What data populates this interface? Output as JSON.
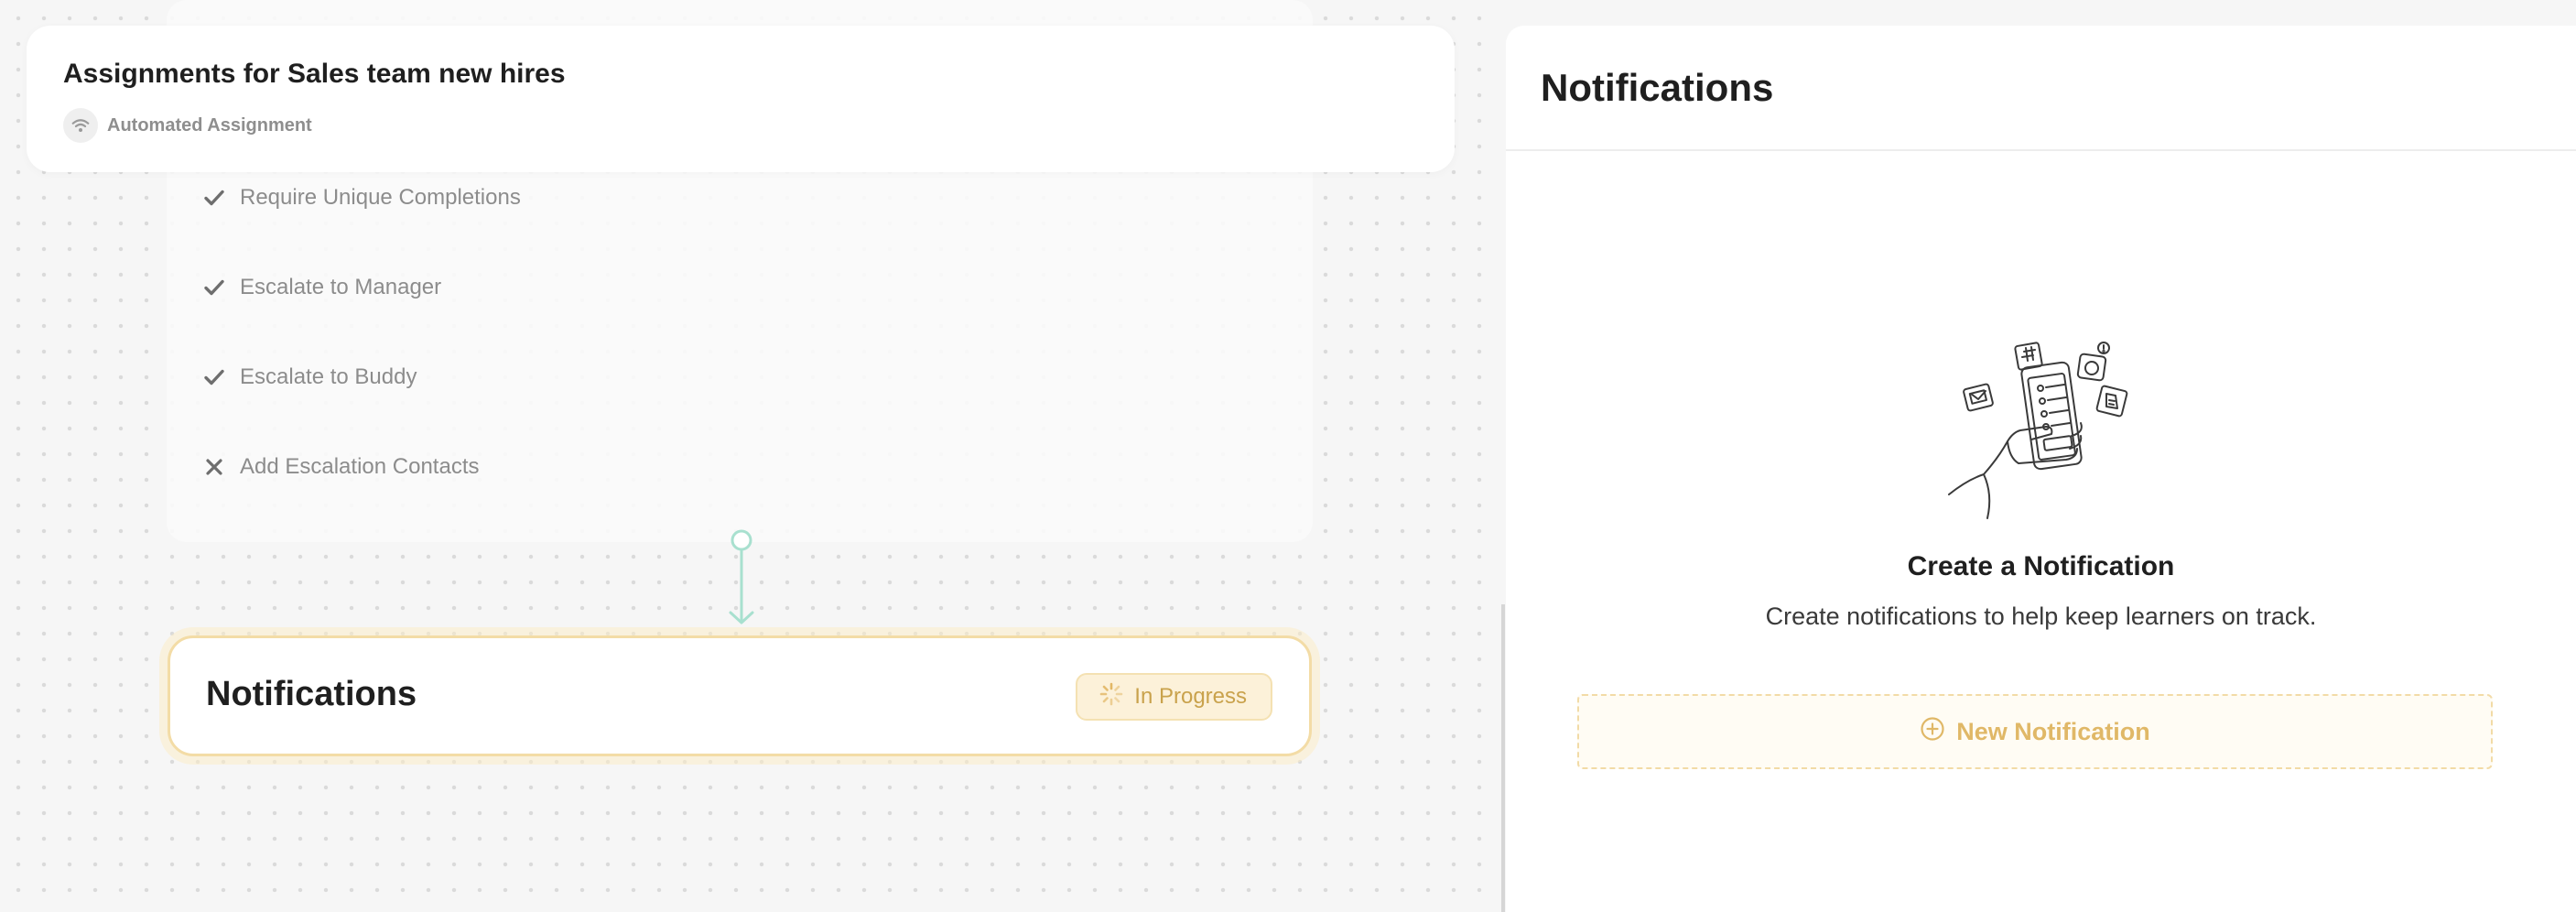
{
  "header": {
    "title": "Assignments for Sales team new hires",
    "subtitle": "Automated Assignment",
    "subtitle_icon": "wifi-icon"
  },
  "steps": [
    {
      "label": "Require Unique Completions",
      "state": "enabled",
      "icon": "check-icon"
    },
    {
      "label": "Escalate to Manager",
      "state": "enabled",
      "icon": "check-icon"
    },
    {
      "label": "Escalate to Buddy",
      "state": "enabled",
      "icon": "check-icon"
    },
    {
      "label": "Add Escalation Contacts",
      "state": "disabled",
      "icon": "x-icon"
    }
  ],
  "notifications_node": {
    "title": "Notifications",
    "status": "In Progress",
    "status_icon": "spinner-icon"
  },
  "panel": {
    "title": "Notifications",
    "empty_title": "Create a Notification",
    "empty_description": "Create notifications to help keep learners on track.",
    "new_button_label": "New Notification",
    "new_button_icon": "plus-circle-icon",
    "illustration": "hand-holding-phone-illustration"
  },
  "colors": {
    "accent": "#e0b867",
    "status_bg": "#fcf1d9",
    "connector": "#a8e0cf",
    "node_border": "#f3dca6"
  }
}
